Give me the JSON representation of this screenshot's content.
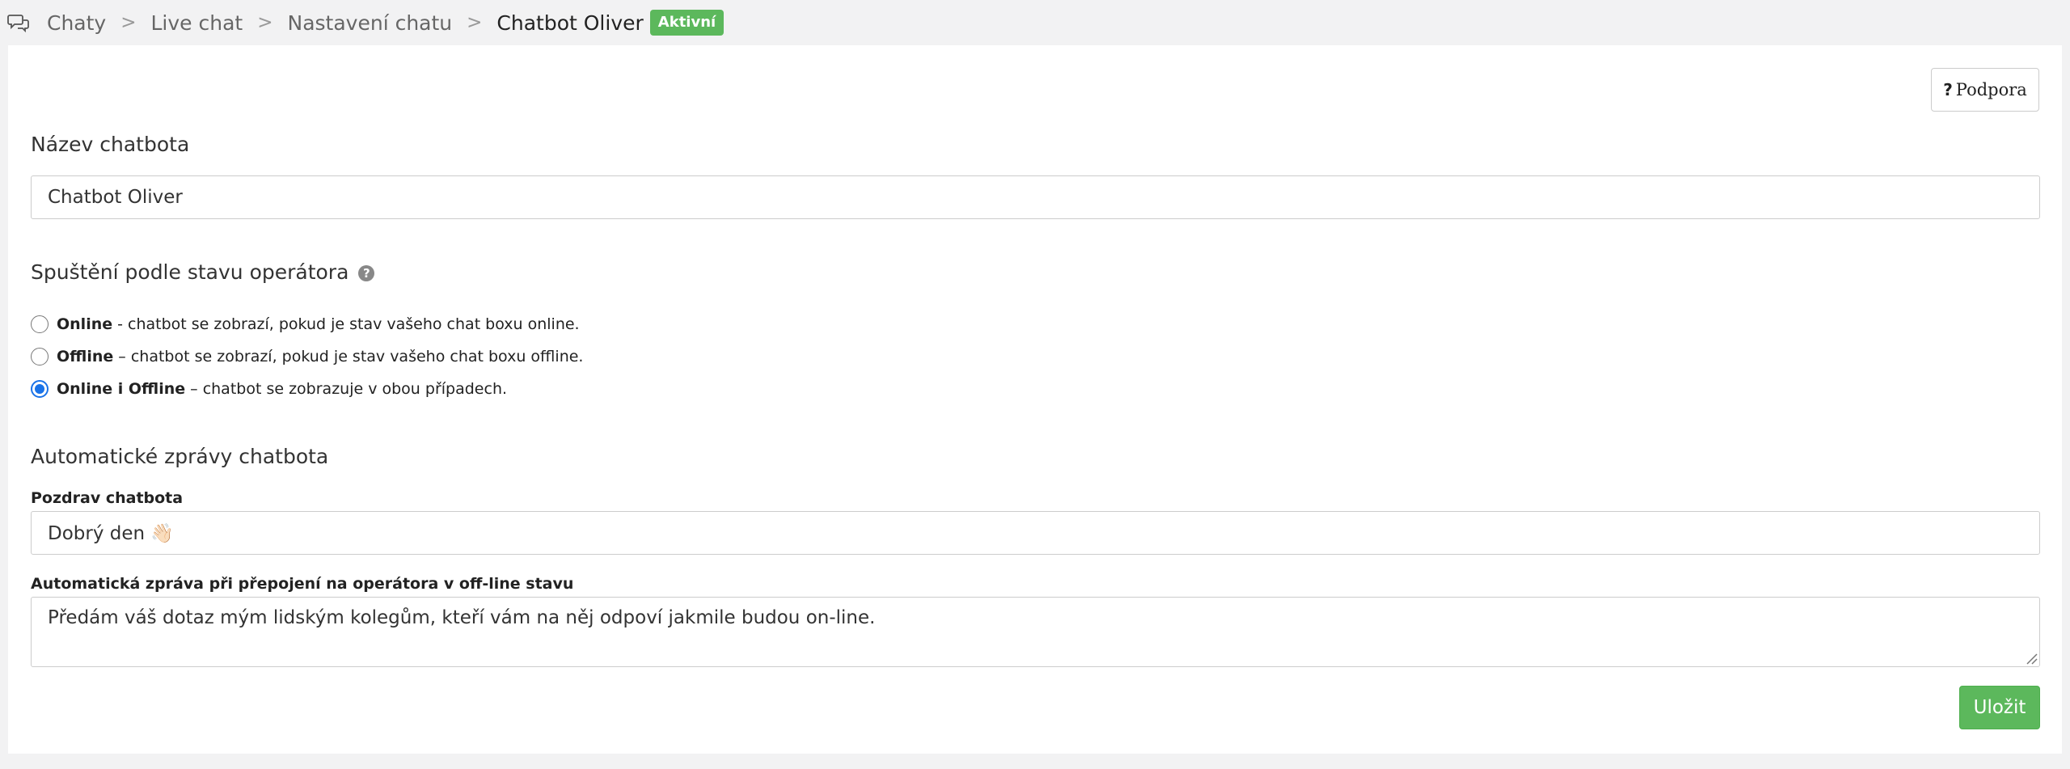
{
  "breadcrumb": {
    "icon": "chat-bubbles-icon",
    "items": [
      "Chaty",
      "Live chat",
      "Nastavení chatu"
    ],
    "separator": ">",
    "current": "Chatbot Oliver",
    "badge": "Aktivní"
  },
  "support": {
    "icon_glyph": "?",
    "label": "Podpora"
  },
  "name_section": {
    "label": "Název chatbota",
    "value": "Chatbot Oliver"
  },
  "trigger_section": {
    "label": "Spuštění podle stavu operátora",
    "help_glyph": "?",
    "options": [
      {
        "bold": "Online",
        "text": "- chatbot se zobrazí, pokud je stav vašeho chat boxu online.",
        "checked": false
      },
      {
        "bold": "Offline",
        "text": "– chatbot se zobrazí, pokud je stav vašeho chat boxu offline.",
        "checked": false
      },
      {
        "bold": "Online i Offline",
        "text": "– chatbot se zobrazuje v obou případech.",
        "checked": true
      }
    ]
  },
  "auto_messages": {
    "heading": "Automatické zprávy chatbota",
    "greeting_label": "Pozdrav chatbota",
    "greeting_value": "Dobrý den 👋🏻",
    "offline_label": "Automatická zpráva při přepojení na operátora v off-line stavu",
    "offline_value": "Předám váš dotaz mým lidským kolegům, kteří vám na něj odpoví jakmile budou on-line."
  },
  "save_label": "Uložit",
  "colors": {
    "accent_green": "#5cb85c",
    "radio_blue": "#1a73e8"
  }
}
